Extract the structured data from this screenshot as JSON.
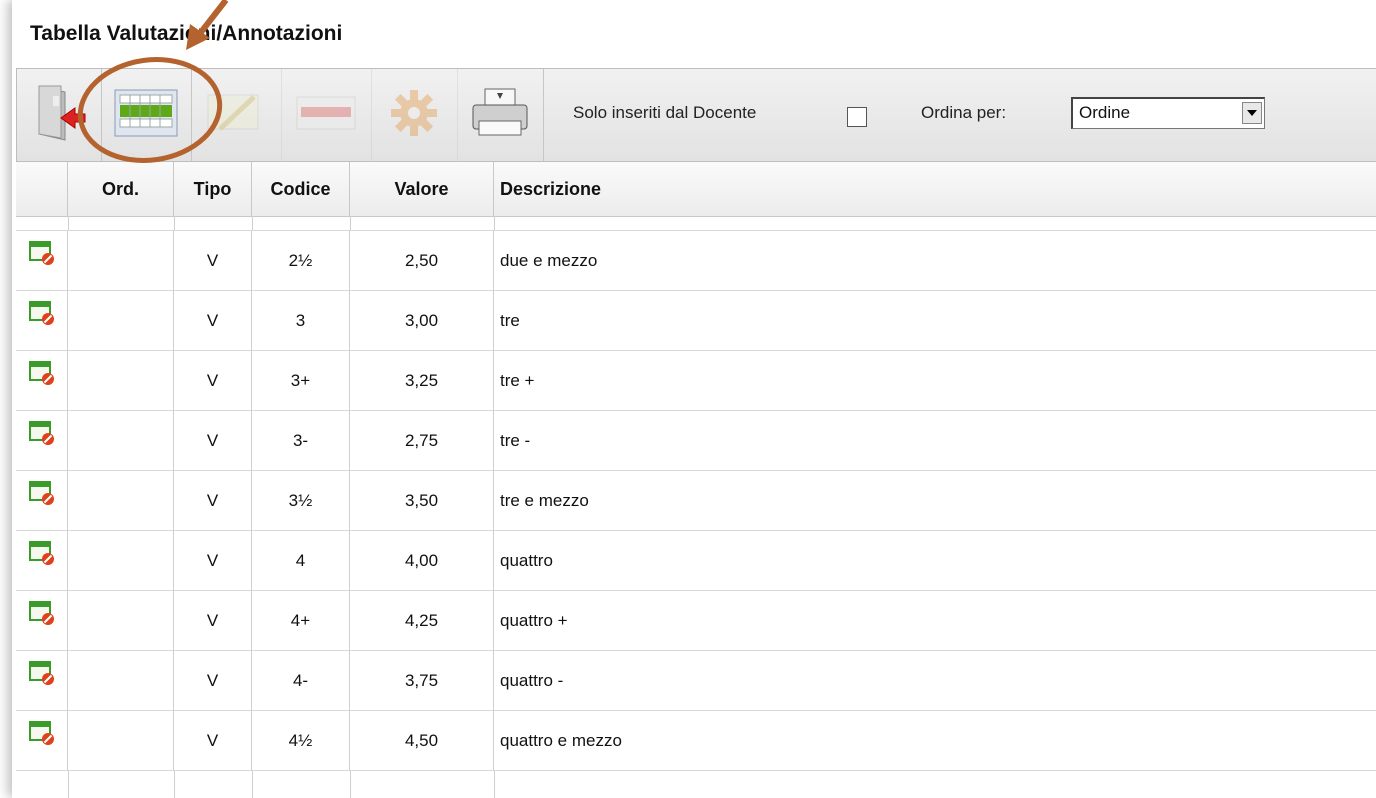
{
  "title": "Tabella Valutazioni/Annotazioni",
  "toolbar": {
    "buttons": [
      {
        "name": "exit",
        "icon": "exit-door-icon"
      },
      {
        "name": "table-view",
        "icon": "table-grid-icon"
      },
      {
        "name": "edit",
        "icon": "edit-pencil-icon"
      },
      {
        "name": "delete",
        "icon": "remove-row-icon"
      },
      {
        "name": "settings",
        "icon": "gear-icon"
      },
      {
        "name": "print",
        "icon": "printer-icon"
      }
    ],
    "filter_label": "Solo inseriti dal Docente",
    "filter_checked": false,
    "sort_label": "Ordina per:",
    "sort_value": "Ordine"
  },
  "columns": [
    "",
    "Ord.",
    "Tipo",
    "Codice",
    "Valore",
    "Descrizione"
  ],
  "rows": [
    {
      "ord": "",
      "tipo": "V",
      "codice": "2½",
      "valore": "2,50",
      "descrizione": "due e mezzo"
    },
    {
      "ord": "",
      "tipo": "V",
      "codice": "3",
      "valore": "3,00",
      "descrizione": "tre"
    },
    {
      "ord": "",
      "tipo": "V",
      "codice": "3+",
      "valore": "3,25",
      "descrizione": "tre +"
    },
    {
      "ord": "",
      "tipo": "V",
      "codice": "3-",
      "valore": "2,75",
      "descrizione": "tre -"
    },
    {
      "ord": "",
      "tipo": "V",
      "codice": "3½",
      "valore": "3,50",
      "descrizione": "tre e mezzo"
    },
    {
      "ord": "",
      "tipo": "V",
      "codice": "4",
      "valore": "4,00",
      "descrizione": "quattro"
    },
    {
      "ord": "",
      "tipo": "V",
      "codice": "4+",
      "valore": "4,25",
      "descrizione": "quattro +"
    },
    {
      "ord": "",
      "tipo": "V",
      "codice": "4-",
      "valore": "3,75",
      "descrizione": "quattro -"
    },
    {
      "ord": "",
      "tipo": "V",
      "codice": "4½",
      "valore": "4,50",
      "descrizione": "quattro e mezzo"
    }
  ],
  "colors": {
    "annotation": "#b5632e",
    "row_icon_green": "#3a9a2a",
    "row_icon_red": "#e0401c"
  }
}
